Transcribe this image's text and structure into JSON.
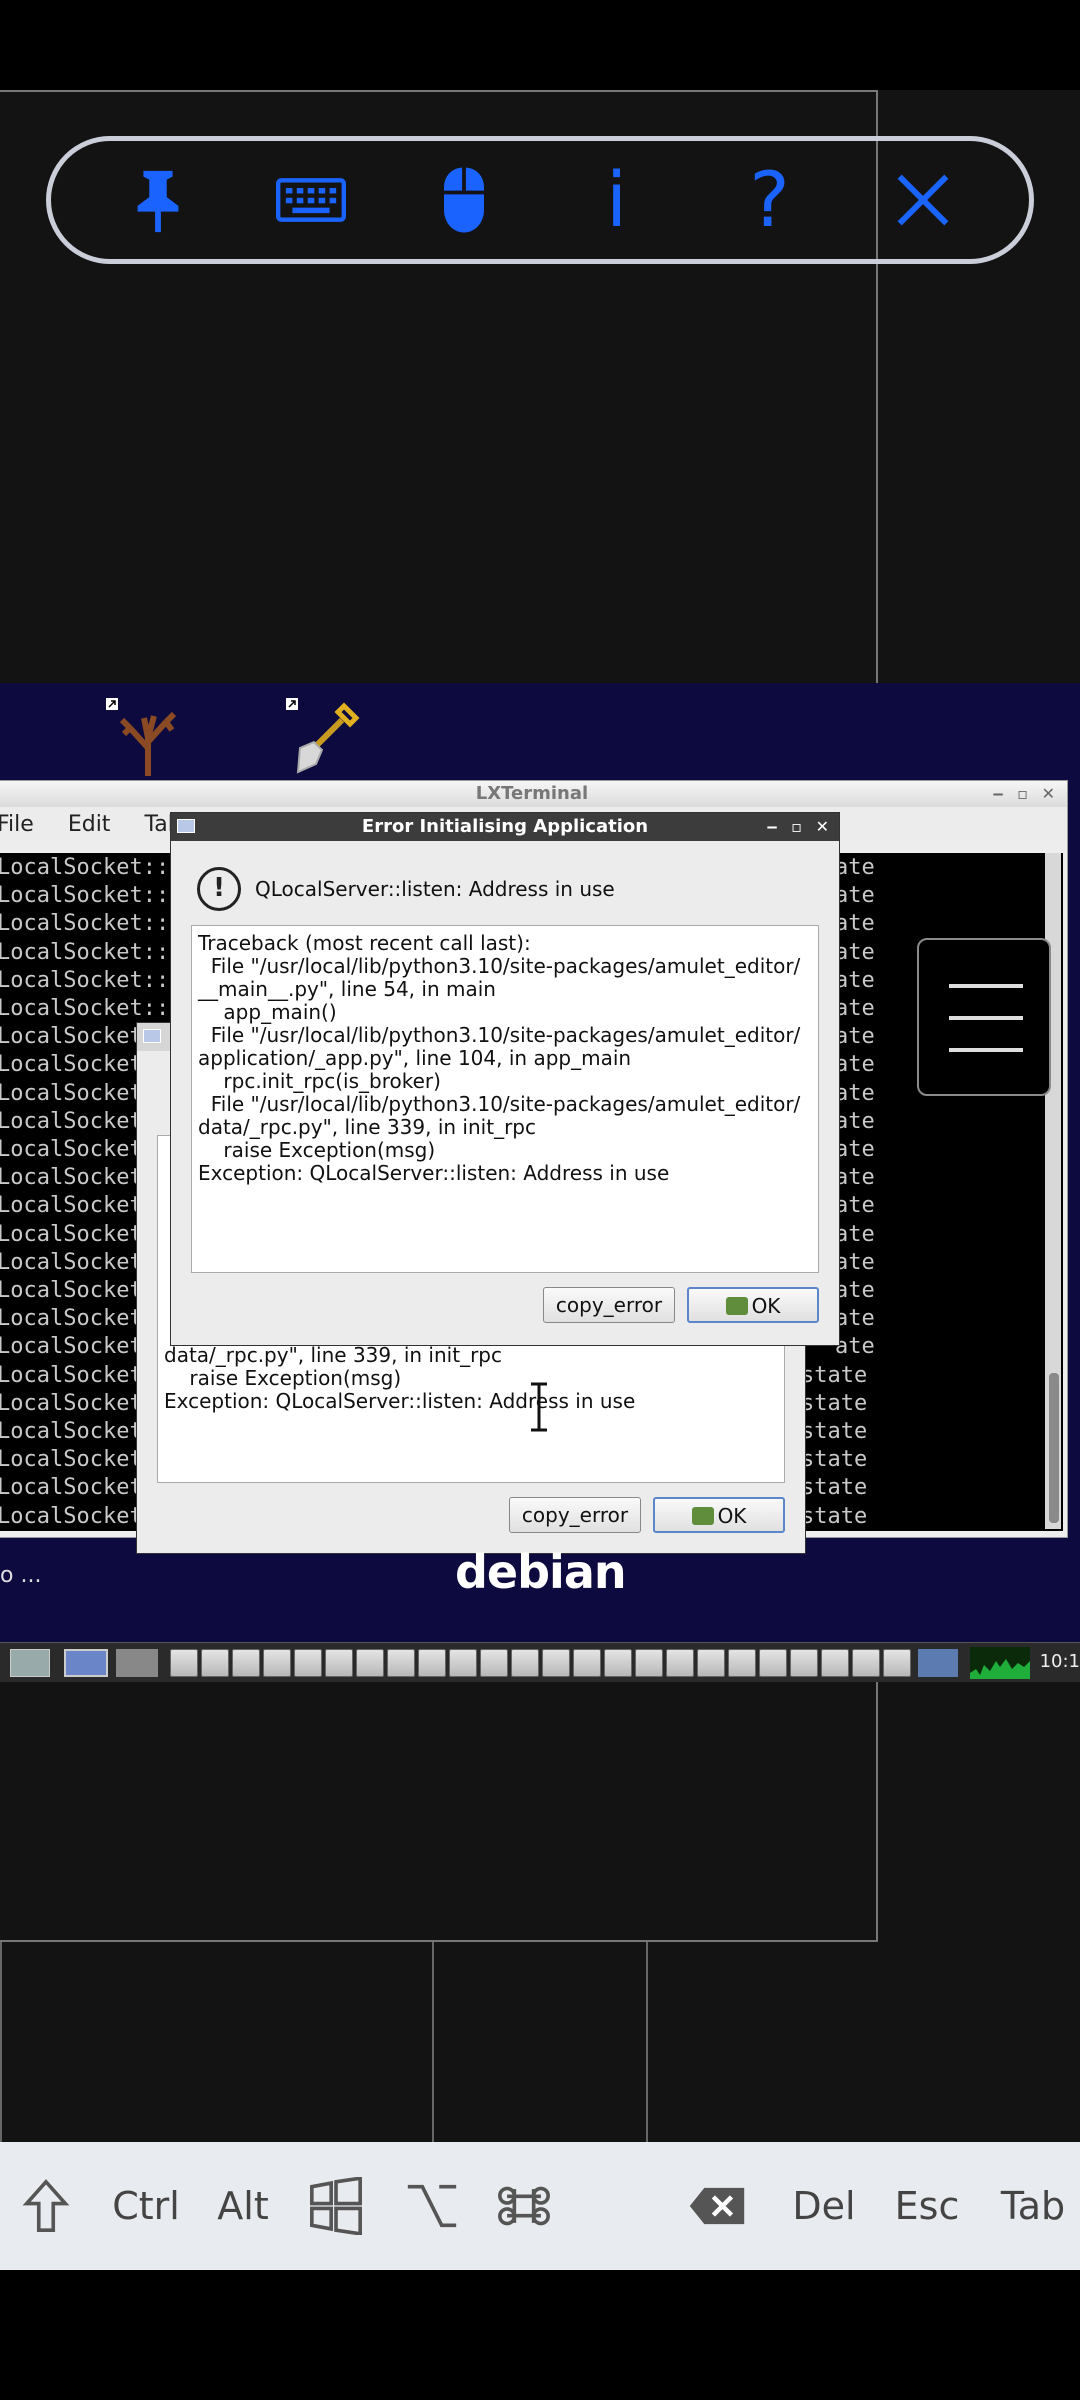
{
  "toolbar": {
    "buttons": [
      {
        "name": "pin-icon"
      },
      {
        "name": "keyboard-icon"
      },
      {
        "name": "mouse-icon"
      },
      {
        "name": "info",
        "label": "i"
      },
      {
        "name": "help",
        "label": "?"
      },
      {
        "name": "close-icon"
      }
    ],
    "accent": "#1a63ff"
  },
  "terminal": {
    "title": "LXTerminal",
    "menu": [
      "File",
      "Edit",
      "Tabs"
    ],
    "lines_left": [
      "LocalSocket::",
      "LocalSocket::",
      "LocalSocket::",
      "LocalSocket::",
      "LocalSocket::",
      "LocalSocket::",
      "LocalSocket",
      "LocalSocket",
      "LocalSocket",
      "LocalSocket",
      "LocalSocket",
      "LocalSocket",
      "LocalSocket",
      "LocalSocket",
      "LocalSocket",
      "LocalSocket",
      "LocalSocket",
      "LocalSocket",
      "LocalSocket",
      "LocalSocket",
      "LocalSocket",
      "LocalSocket",
      "LocalSocket",
      "LocalSocket"
    ],
    "lines_right": [
      "ate",
      "ate",
      "ate",
      "ate",
      "ate",
      "ate",
      "ate",
      "ate",
      "ate",
      "ate",
      "ate",
      "ate",
      "ate",
      "ate",
      "ate",
      "ate",
      "ate",
      "ate",
      "state",
      "state",
      "state",
      "state",
      "state",
      "state"
    ]
  },
  "dialog_front": {
    "title": "Error Initialising Application",
    "message": "QLocalServer::listen: Address in use",
    "traceback": "Traceback (most recent call last):\n  File \"/usr/local/lib/python3.10/site-packages/amulet_editor/\n__main__.py\", line 54, in main\n    app_main()\n  File \"/usr/local/lib/python3.10/site-packages/amulet_editor/\napplication/_app.py\", line 104, in app_main\n    rpc.init_rpc(is_broker)\n  File \"/usr/local/lib/python3.10/site-packages/amulet_editor/\ndata/_rpc.py\", line 339, in init_rpc\n    raise Exception(msg)\nException: QLocalServer::listen: Address in use",
    "copy_label": "copy_error",
    "ok_label": "OK"
  },
  "dialog_back": {
    "traceback_visible": "data/_rpc.py\", line 339, in init_rpc\n    raise Exception(msg)\nException: QLocalServer::listen: Address in use",
    "copy_label": "copy_error",
    "ok_label": "OK"
  },
  "desktop": {
    "launch_text": "o ...",
    "logo_text": "debian"
  },
  "taskbar": {
    "clock": "10:1"
  },
  "keys": {
    "shift": "shift-icon",
    "ctrl": "Ctrl",
    "alt": "Alt",
    "win": "windows-icon",
    "option": "option-icon",
    "cmd": "command-icon",
    "backspace": "backspace-icon",
    "del": "Del",
    "esc": "Esc",
    "tab": "Tab"
  }
}
